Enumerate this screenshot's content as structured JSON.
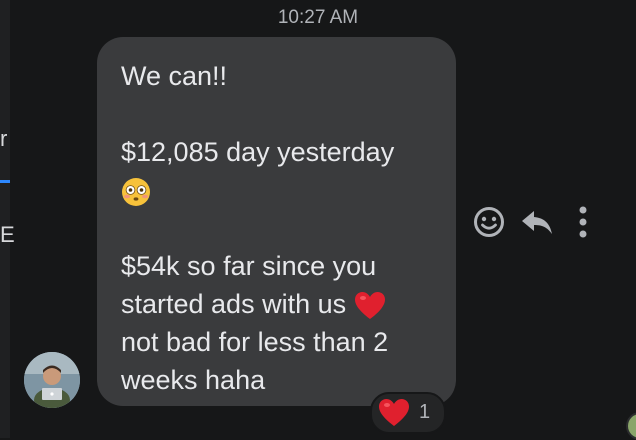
{
  "left_panel": {
    "glyph_top": "r",
    "glyph_bottom": "E"
  },
  "conversation": {
    "timestamp": "10:27 AM",
    "message": {
      "lines": [
        "We can!!",
        "",
        "$12,085 day yesterday",
        "",
        "",
        "$54k so far since you",
        "started ads with us",
        "not bad for less than 2",
        "weeks haha"
      ],
      "inline_emojis": [
        "flushed-face",
        "red-heart"
      ],
      "reaction": {
        "emoji": "red-heart",
        "count": "1"
      }
    },
    "actions": [
      "react-icon",
      "reply-icon",
      "more-options-icon"
    ]
  },
  "colors": {
    "background": "#161718",
    "bubble": "#3a3b3d",
    "heart": "#e0202e",
    "accent": "#2d88ff"
  }
}
